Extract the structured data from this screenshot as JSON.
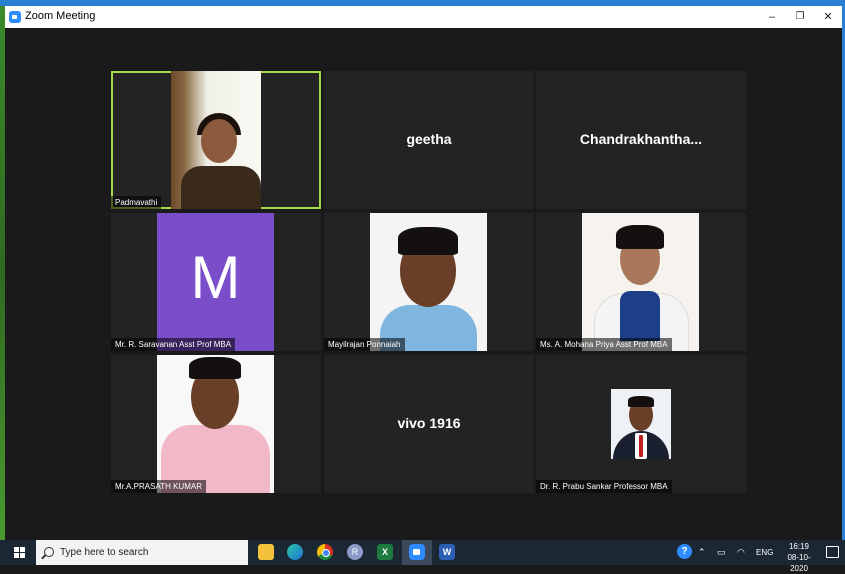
{
  "window": {
    "title": "Zoom Meeting",
    "controls": {
      "minimize": "–",
      "restore": "❐",
      "close": "✕"
    }
  },
  "participants": [
    {
      "name": "Padmavathi",
      "type": "video",
      "active_speaker": true
    },
    {
      "name": "geetha",
      "type": "name_only"
    },
    {
      "name": "Chandrakhantha...",
      "type": "name_only"
    },
    {
      "name": "Mr. R. Saravanan Asst Prof MBA",
      "type": "avatar",
      "avatar_letter": "M",
      "avatar_color": "#7a4dc9"
    },
    {
      "name": "Mayilrajan Ponnaiah",
      "type": "photo"
    },
    {
      "name": "Ms. A. Mohana Priya Asst Prof MBA",
      "type": "photo"
    },
    {
      "name": "Mr.A.PRASATH KUMAR",
      "type": "photo"
    },
    {
      "name": "vivo 1916",
      "type": "name_only"
    },
    {
      "name": "Dr. R. Prabu Sankar Professor MBA",
      "type": "photo"
    }
  ],
  "colors": {
    "active_speaker_border": "#a6d84a",
    "tile_background": "#232323",
    "stage_background": "#1a1a1a",
    "taskbar": "#1b2733"
  },
  "taskbar": {
    "search_placeholder": "Type here to search",
    "apps": [
      "file-explorer-icon",
      "edge-icon",
      "chrome-icon",
      "r-app-icon",
      "excel-icon",
      "zoom-icon",
      "word-icon"
    ],
    "excel_letter": "X",
    "word_letter": "W",
    "r_letter": "R",
    "language": "ENG",
    "time": "16:19",
    "date": "08-10-2020"
  }
}
